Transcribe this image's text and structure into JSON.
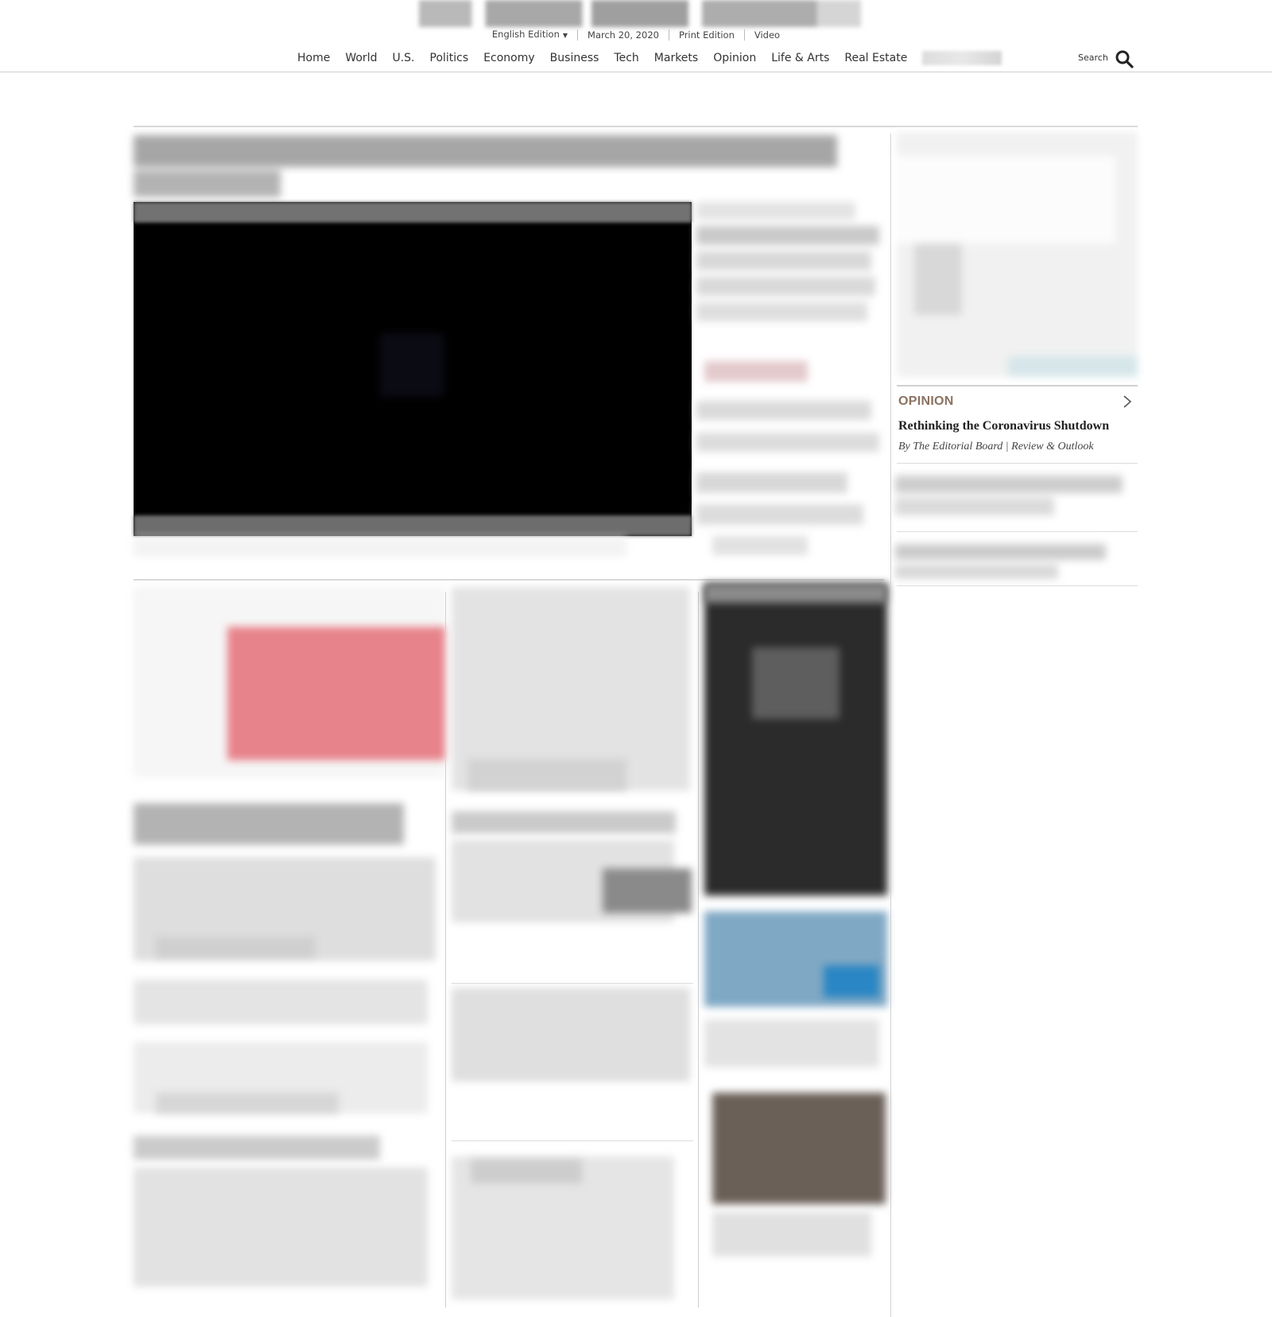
{
  "header": {
    "edition": "English Edition",
    "date": "March 20, 2020",
    "print_edition": "Print Edition",
    "video": "Video",
    "search_label": "Search"
  },
  "nav": {
    "items": [
      "Home",
      "World",
      "U.S.",
      "Politics",
      "Economy",
      "Business",
      "Tech",
      "Markets",
      "Opinion",
      "Life & Arts",
      "Real Estate"
    ]
  },
  "opinion": {
    "label": "OPINION",
    "title": "Rethinking the Coronavirus Shutdown",
    "byline": "By The Editorial Board | Review & Outlook"
  },
  "colors": {
    "opinion_label": "#8b7261",
    "rule": "#d0d0d0",
    "text": "#222222"
  },
  "icons": {
    "search": "search-icon",
    "edition_caret": "caret-down-icon",
    "opinion_more": "chevron-right-icon"
  }
}
